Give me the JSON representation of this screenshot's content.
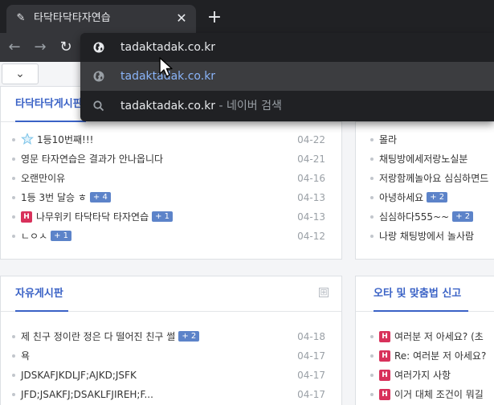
{
  "browser": {
    "tab_title": "타닥타닥타자연습",
    "url_text": "tadaktadak.co.kr",
    "suggestions": [
      {
        "text": "tadaktadak.co.kr",
        "suffix": "",
        "type": "globe"
      },
      {
        "text": "tadaktadak.co.kr",
        "suffix": " - 네이버 검색",
        "type": "search"
      }
    ]
  },
  "page": {
    "top_left_card": {
      "title": "타닥타닥게시판",
      "items": [
        {
          "text": "1등10번째!!!",
          "date": "04-22",
          "badge": "",
          "icon": "star"
        },
        {
          "text": "영문 타자연습은 결과가 안나옵니다",
          "date": "04-21",
          "badge": "",
          "icon": ""
        },
        {
          "text": "오랜만이유",
          "date": "04-16",
          "badge": "",
          "icon": ""
        },
        {
          "text": "1등 3번 달승 ㅎ",
          "date": "04-13",
          "badge": "+ 4",
          "icon": ""
        },
        {
          "text": "나무위키 타닥타닥 타자연습",
          "date": "04-13",
          "badge": "+ 1",
          "icon": "H"
        },
        {
          "text": "ㄴㅇㅅ",
          "date": "04-12",
          "badge": "+ 1",
          "icon": ""
        }
      ]
    },
    "top_right_card": {
      "items": [
        {
          "text": "몰라",
          "badge": "",
          "icon": ""
        },
        {
          "text": "채팅방에세저랑노실분",
          "badge": "",
          "icon": ""
        },
        {
          "text": "저랑함께놀아요 심심하면드",
          "badge": "",
          "icon": ""
        },
        {
          "text": "아녕하세요",
          "badge": "+ 2",
          "icon": ""
        },
        {
          "text": "심심하다555~~",
          "badge": "+ 2",
          "icon": ""
        },
        {
          "text": "나랑 채팅방에서 놀사람",
          "badge": "",
          "icon": ""
        }
      ]
    },
    "bottom_left_card": {
      "title": "자유게시판",
      "more_icon": "⊞",
      "items": [
        {
          "text": "제 친구 정이란 정은 다 떨어진 친구 썰",
          "date": "04-18",
          "badge": "+ 2"
        },
        {
          "text": "욕",
          "date": "04-17",
          "badge": ""
        },
        {
          "text": "JDSKAFJKDLJF;AJKD;JSFK",
          "date": "04-17",
          "badge": ""
        },
        {
          "text": "JFD;JSAKFJ;DSAKLFJIREH;F...",
          "date": "04-17",
          "badge": ""
        }
      ]
    },
    "bottom_right_card": {
      "title": "오타 및 맞춤법 신고",
      "items": [
        {
          "text": "여러분 저 아세요? (초",
          "icon": "H"
        },
        {
          "text": "Re: 여러분 저 아세요?",
          "icon": "H"
        },
        {
          "text": "여러가지 사항",
          "icon": "H"
        },
        {
          "text": "이거 대체 조건이 뭐길",
          "icon": "H"
        }
      ]
    }
  },
  "colors": {
    "accent": "#3a62c6",
    "badge": "#5c83c9",
    "hbadge": "#d8315b",
    "omnibox_bg": "#202124",
    "link": "#8ab4f8"
  }
}
